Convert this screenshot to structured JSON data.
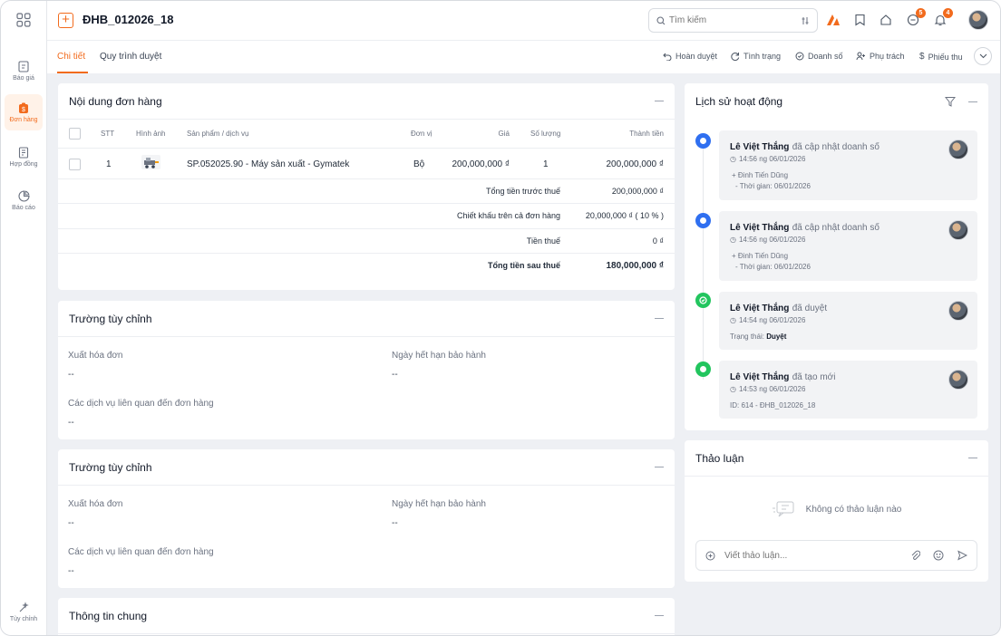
{
  "header": {
    "title": "ĐHB_012026_18",
    "search_placeholder": "Tìm kiếm",
    "message_badge": "5",
    "notification_badge": "4"
  },
  "sidebar": {
    "items": [
      {
        "label": "Báo giá"
      },
      {
        "label": "Đơn hàng"
      },
      {
        "label": "Hợp đồng"
      },
      {
        "label": "Báo cáo"
      },
      {
        "label": "Tùy chỉnh"
      }
    ]
  },
  "tabs": [
    {
      "label": "Chi tiết"
    },
    {
      "label": "Quy trình duyệt"
    }
  ],
  "actions": [
    {
      "label": "Hoàn duyệt"
    },
    {
      "label": "Tình trạng"
    },
    {
      "label": "Doanh số"
    },
    {
      "label": "Phụ trách"
    },
    {
      "label": "Phiếu thu"
    }
  ],
  "order": {
    "title": "Nội dung đơn hàng",
    "columns": [
      "STT",
      "Hình ảnh",
      "Sản phẩm / dịch vụ",
      "Đơn vị",
      "Giá",
      "Số lượng",
      "Thành tiền"
    ],
    "rows": [
      {
        "stt": "1",
        "product": "SP.052025.90 - Máy sản xuất - Gymatek",
        "unit": "Bộ",
        "price": "200,000,000 ₫",
        "qty": "1",
        "total": "200,000,000 ₫"
      }
    ],
    "summary": [
      {
        "label": "Tổng tiền trước thuế",
        "value": "200,000,000 ₫"
      },
      {
        "label": "Chiết khấu trên cả đơn hàng",
        "value": "20,000,000 ₫ ( 10 % )"
      },
      {
        "label": "Tiền thuế",
        "value": "0 ₫"
      },
      {
        "label": "Tổng tiền sau thuế",
        "value": "180,000,000 ₫"
      }
    ]
  },
  "custom1": {
    "title": "Trường tùy chỉnh",
    "f1_label": "Xuất hóa đơn",
    "f1_value": "--",
    "f2_label": "Ngày hết hạn bảo hành",
    "f2_value": "--",
    "f3_label": "Các dịch vụ liên quan đến đơn hàng",
    "f3_value": "--"
  },
  "custom2": {
    "title": "Trường tùy chỉnh",
    "f1_label": "Xuất hóa đơn",
    "f1_value": "--",
    "f2_label": "Ngày hết hạn bảo hành",
    "f2_value": "--",
    "f3_label": "Các dịch vụ liên quan đến đơn hàng",
    "f3_value": "--"
  },
  "general": {
    "title": "Thông tin chung"
  },
  "history": {
    "title": "Lịch sử hoạt động",
    "items": [
      {
        "name": "Lê Việt Thắng",
        "action": "đã cập nhật doanh số",
        "time": "14:56 ng 06/01/2026",
        "line1": "+ Đinh Tiến Dũng",
        "line2": "- Thời gian: 06/01/2026",
        "color": "#2f6ff0"
      },
      {
        "name": "Lê Việt Thắng",
        "action": "đã cập nhật doanh số",
        "time": "14:56 ng 06/01/2026",
        "line1": "+ Đinh Tiến Dũng",
        "line2": "- Thời gian: 06/01/2026",
        "color": "#2f6ff0"
      },
      {
        "name": "Lê Việt Thắng",
        "action": "đã duyệt",
        "time": "14:54 ng 06/01/2026",
        "status_label": "Trạng thái:",
        "status_value": "Duyệt",
        "color": "#22c55e"
      },
      {
        "name": "Lê Việt Thắng",
        "action": "đã tạo mới",
        "time": "14:53 ng 06/01/2026",
        "line1": "ID: 614 - ĐHB_012026_18",
        "color": "#22c55e"
      }
    ]
  },
  "discussion": {
    "title": "Thảo luận",
    "empty": "Không có thảo luận nào",
    "placeholder": "Viết thảo luận..."
  }
}
